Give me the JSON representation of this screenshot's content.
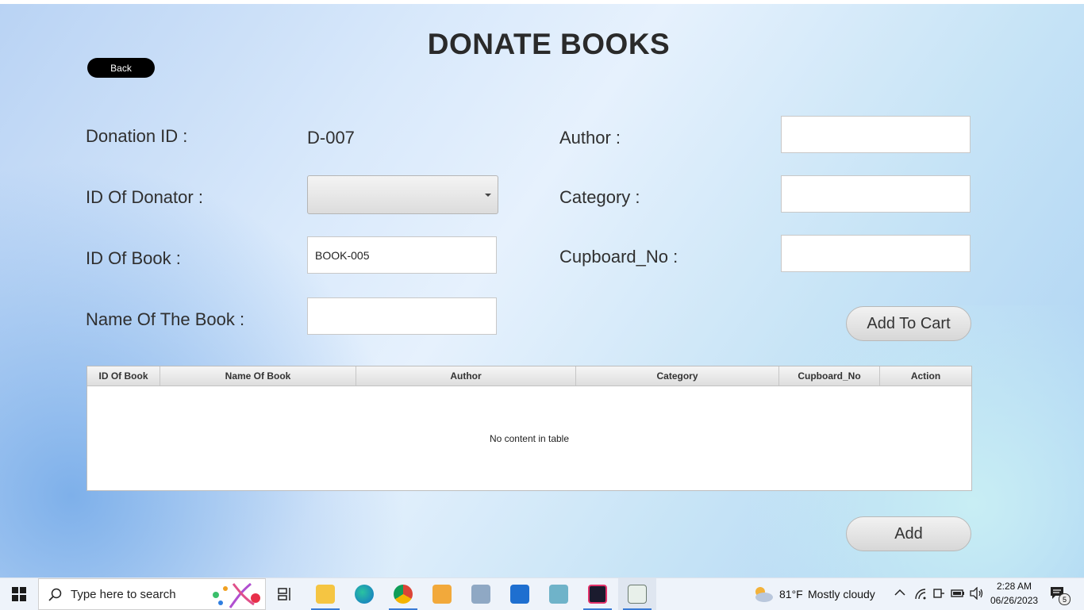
{
  "page": {
    "title": "DONATE BOOKS",
    "back_label": "Back"
  },
  "form": {
    "donation_id_label": "Donation ID :",
    "donation_id_value": "D-007",
    "donator_label": "ID Of Donator :",
    "donator_value": "",
    "book_id_label": "ID Of Book :",
    "book_id_value": "BOOK-005",
    "book_name_label": "Name Of The Book :",
    "book_name_value": "",
    "author_label": "Author :",
    "author_value": "",
    "category_label": "Category :",
    "category_value": "",
    "cupboard_label": "Cupboard_No :",
    "cupboard_value": "",
    "add_to_cart_label": "Add To Cart",
    "add_label": "Add"
  },
  "table": {
    "columns": [
      "ID Of Book",
      "Name Of Book",
      "Author",
      "Category",
      "Cupboard_No",
      "Action"
    ],
    "empty_message": "No content in table"
  },
  "taskbar": {
    "search_placeholder": "Type here to search",
    "weather_temp": "81°F",
    "weather_desc": "Mostly cloudy",
    "time": "2:28 AM",
    "date": "06/26/2023",
    "notification_count": "5"
  }
}
